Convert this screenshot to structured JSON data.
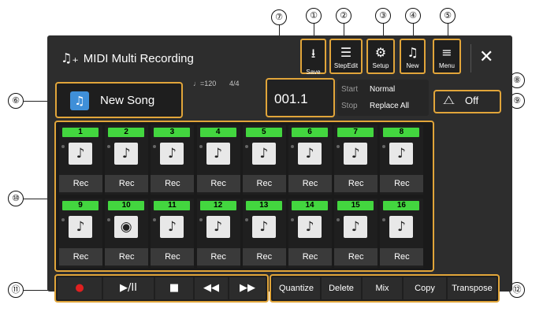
{
  "header": {
    "title": "MIDI Multi Recording",
    "title_icon": "music-note-plus-icon",
    "close_icon": "close-icon"
  },
  "toolbar": [
    {
      "id": "save",
      "label": "Save",
      "icon": "save-icon",
      "glyph": "⭳"
    },
    {
      "id": "stepedit",
      "label": "StepEdit",
      "icon": "step-edit-icon",
      "glyph": "☰"
    },
    {
      "id": "setup",
      "label": "Setup",
      "icon": "setup-icon",
      "glyph": "⚙"
    },
    {
      "id": "new",
      "label": "New",
      "icon": "new-icon",
      "glyph": "♫"
    },
    {
      "id": "menu",
      "label": "Menu",
      "icon": "menu-icon",
      "glyph": "≡"
    }
  ],
  "song": {
    "name": "New Song",
    "icon": "song-icon",
    "tempo": "♩=120",
    "time_signature": "4/4"
  },
  "position": "001.1",
  "record_settings": {
    "start_label": "Start",
    "start_value": "Normal",
    "stop_label": "Stop",
    "stop_value": "Replace All"
  },
  "metronome": {
    "icon": "metronome-icon",
    "value": "Off"
  },
  "tracks": [
    {
      "num": "1",
      "icon": "piano-icon",
      "rec": "Rec"
    },
    {
      "num": "2",
      "icon": "piano-icon",
      "rec": "Rec"
    },
    {
      "num": "3",
      "icon": "piano-icon",
      "rec": "Rec"
    },
    {
      "num": "4",
      "icon": "piano-icon",
      "rec": "Rec"
    },
    {
      "num": "5",
      "icon": "piano-icon",
      "rec": "Rec"
    },
    {
      "num": "6",
      "icon": "piano-icon",
      "rec": "Rec"
    },
    {
      "num": "7",
      "icon": "piano-icon",
      "rec": "Rec"
    },
    {
      "num": "8",
      "icon": "piano-icon",
      "rec": "Rec"
    },
    {
      "num": "9",
      "icon": "piano-icon",
      "rec": "Rec"
    },
    {
      "num": "10",
      "icon": "drum-icon",
      "rec": "Rec"
    },
    {
      "num": "11",
      "icon": "piano-icon",
      "rec": "Rec"
    },
    {
      "num": "12",
      "icon": "piano-icon",
      "rec": "Rec"
    },
    {
      "num": "13",
      "icon": "piano-icon",
      "rec": "Rec"
    },
    {
      "num": "14",
      "icon": "piano-icon",
      "rec": "Rec"
    },
    {
      "num": "15",
      "icon": "piano-icon",
      "rec": "Rec"
    },
    {
      "num": "16",
      "icon": "piano-icon",
      "rec": "Rec"
    }
  ],
  "transport": [
    {
      "id": "record",
      "icon": "record-icon",
      "glyph": "●",
      "color": "#e02020"
    },
    {
      "id": "play-pause",
      "icon": "play-pause-icon",
      "glyph": "▶/II",
      "color": "#ffffff"
    },
    {
      "id": "stop",
      "icon": "stop-icon",
      "glyph": "■",
      "color": "#ffffff"
    },
    {
      "id": "rewind",
      "icon": "rewind-icon",
      "glyph": "◀◀",
      "color": "#ffffff"
    },
    {
      "id": "fast-forward",
      "icon": "fast-forward-icon",
      "glyph": "▶▶",
      "color": "#ffffff"
    }
  ],
  "edit_buttons": [
    "Quantize",
    "Delete",
    "Mix",
    "Copy",
    "Transpose"
  ],
  "callouts": [
    "①",
    "②",
    "③",
    "④",
    "⑤",
    "⑥",
    "⑦",
    "⑧",
    "⑨",
    "⑩",
    "⑪",
    "⑫"
  ],
  "colors": {
    "accent": "#e1a53a",
    "track_number": "#43d63f",
    "background": "#2d2d2d",
    "record": "#e02020"
  }
}
